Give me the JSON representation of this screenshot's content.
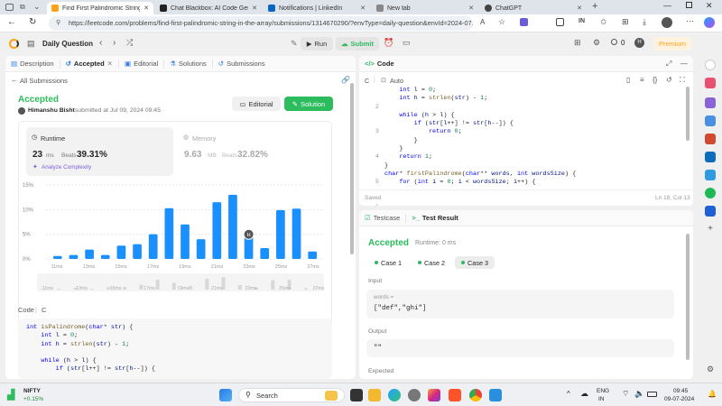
{
  "browser": {
    "tabs": [
      {
        "title": "Find First Palindromic String in t",
        "color": "#ffa116",
        "active": true
      },
      {
        "title": "Chat Blackbox: AI Code Generatio",
        "color": "#222222",
        "active": false
      },
      {
        "title": "Notifications | LinkedIn",
        "color": "#0a66c2",
        "active": false
      },
      {
        "title": "New tab",
        "color": "#888888",
        "active": false
      },
      {
        "title": "ChatGPT",
        "color": "#444444",
        "active": false
      }
    ],
    "url": "https://leetcode.com/problems/find-first-palindromic-string-in-the-array/submissions/1314670290/?envType=daily-question&envId=2024-07...",
    "add_tab": "+"
  },
  "leetcode_header": {
    "daily_question": "Daily Question",
    "run": "Run",
    "submit": "Submit",
    "streak_count": "0",
    "avatar_letter": "H",
    "premium": "Premium"
  },
  "left_panel": {
    "tabs": [
      "Description",
      "Accepted",
      "Editorial",
      "Solutions",
      "Submissions"
    ],
    "all_submissions": "All Submissions",
    "status": "Accepted",
    "user": "Himanshu Bisht",
    "submitted_at": "submitted at Jul 09, 2024 09:45",
    "editorial_btn": "Editorial",
    "solution_btn": "Solution",
    "runtime": {
      "label": "Runtime",
      "value": "23",
      "unit": "ms",
      "beats_label": "Beats",
      "beats": "39.31%",
      "analyze": "Analyze Complexity"
    },
    "memory": {
      "label": "Memory",
      "value": "9.63",
      "unit": "MB",
      "beats_label": "Beats",
      "beats": "32.82%"
    },
    "code_label": "Code",
    "code_lang": "C",
    "code_lines": [
      "int isPalindrome(char* str) {",
      "    int l = 0;",
      "    int h = strlen(str) - 1;",
      "",
      "    while (h > l) {",
      "        if (str[l++] != str[h--]) {"
    ]
  },
  "chart_data": {
    "type": "bar",
    "title": "",
    "xlabel": "",
    "ylabel": "",
    "y_ticks": [
      "15%",
      "10%",
      "5%",
      "0%"
    ],
    "ylim": [
      0,
      15
    ],
    "x_tick_labels": [
      "11ms",
      "13ms",
      "15ms",
      "17ms",
      "19ms",
      "21ms",
      "23ms",
      "25ms",
      "27ms"
    ],
    "values": [
      0.6,
      0.8,
      1.9,
      0.8,
      2.7,
      3.0,
      5.0,
      10.3,
      7.0,
      4.0,
      11.5,
      13.0,
      4.8,
      2.2,
      9.9,
      10.2,
      1.5
    ],
    "highlight_index": 12,
    "highlight_label": "H",
    "bar_color": "#1a90ff",
    "grid": true,
    "minimap_labels": [
      "11ms",
      "13ms",
      "15ms",
      "17ms",
      "19ms",
      "21ms",
      "23ms",
      "25ms",
      "27ms"
    ]
  },
  "editor": {
    "tab": "Code",
    "lang": "C",
    "mode": "Auto",
    "line_numbers": [
      "2",
      "3",
      "4",
      "5",
      "6",
      "7",
      "8",
      "9",
      "10",
      "11",
      "12",
      "13"
    ],
    "saved": "Saved",
    "cursor": "Ln 18, Col 13"
  },
  "results": {
    "tabs": [
      "Testcase",
      "Test Result"
    ],
    "status": "Accepted",
    "runtime": "Runtime: 0 ms",
    "cases": [
      "Case 1",
      "Case 2",
      "Case 3"
    ],
    "selected_case": 2,
    "input_label": "Input",
    "words_label": "words =",
    "words_value": "[\"def\",\"ghi\"]",
    "output_label": "Output",
    "output_value": "\"\"",
    "expected_label": "Expected"
  },
  "taskbar": {
    "ticker": "NIFTY",
    "ticker_change": "+0.15%",
    "search": "Search",
    "lang_top": "ENG",
    "lang_bottom": "IN",
    "time": "09:45",
    "date": "09-07-2024"
  }
}
